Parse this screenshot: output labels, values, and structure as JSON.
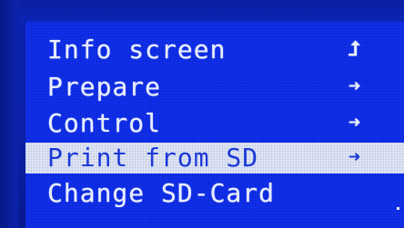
{
  "menu": {
    "items": [
      {
        "label": "Info screen",
        "arrow": "⮥",
        "arrow_icon": "return-arrow-icon",
        "selected": false
      },
      {
        "label": "Prepare",
        "arrow": "➜",
        "arrow_icon": "submenu-arrow-icon",
        "selected": false
      },
      {
        "label": "Control",
        "arrow": "➜",
        "arrow_icon": "submenu-arrow-icon",
        "selected": false
      },
      {
        "label": "Print from SD",
        "arrow": "➜",
        "arrow_icon": "submenu-arrow-icon",
        "selected": true
      },
      {
        "label": "Change SD-Card",
        "arrow": "",
        "arrow_icon": "",
        "selected": false
      }
    ]
  },
  "colors": {
    "background": "#1030f0",
    "text": "#e9eefc",
    "highlight_bg": "#dfe6f6",
    "highlight_text": "#1a38d8"
  }
}
